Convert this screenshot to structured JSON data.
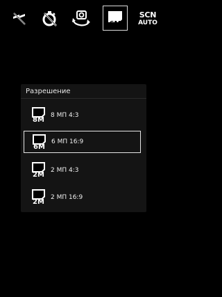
{
  "toolbar": {
    "icons": [
      "flash-off-icon",
      "timer-off-icon",
      "switch-camera-icon",
      "resolution-icon",
      "scene-mode-icon"
    ],
    "resolution_badge": "6M",
    "scene_top": "SCN",
    "scene_bottom": "AUTO"
  },
  "panel": {
    "title": "Разрешение",
    "options": [
      {
        "badge": "8M",
        "label": "8 МП 4:3",
        "selected": false
      },
      {
        "badge": "6M",
        "label": "6 МП 16:9",
        "selected": true
      },
      {
        "badge": "2M",
        "label": "2 МП 4:3",
        "selected": false
      },
      {
        "badge": "2M",
        "label": "2 МП 16:9",
        "selected": false
      }
    ]
  }
}
